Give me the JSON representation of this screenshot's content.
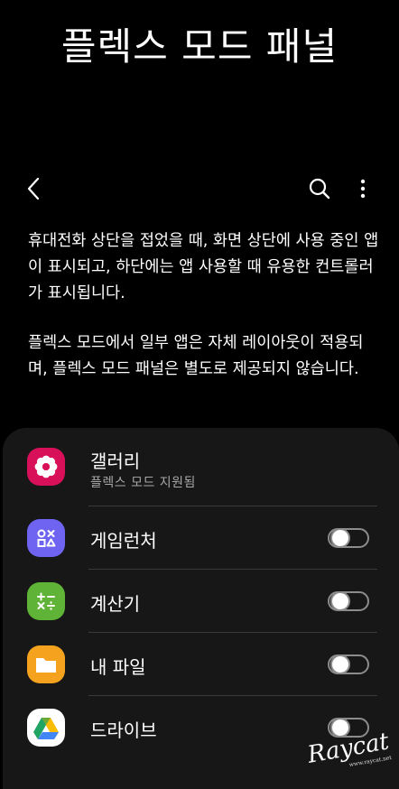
{
  "header": {
    "title": "플렉스 모드 패널"
  },
  "toolbar": {
    "back_icon": "back-arrow-icon",
    "search_icon": "search-icon",
    "more_icon": "more-vertical-icon"
  },
  "description": {
    "line1": "휴대전화 상단을 접었을 때, 화면 상단에 사용 중인 앱이 표시되고, 하단에는 앱 사용할 때 유용한 컨트롤러가 표시됩니다.",
    "line2": "플렉스 모드에서 일부 앱은 자체 레이아웃이 적용되며, 플렉스 모드 패널은 별도로 제공되지 않습니다."
  },
  "apps": [
    {
      "name": "갤러리",
      "subtitle": "플렉스 모드 지원됨",
      "icon": "gallery-icon",
      "color": "#d8105a",
      "toggle": null
    },
    {
      "name": "게임런처",
      "subtitle": "",
      "icon": "game-launcher-icon",
      "color": "#6f63f2",
      "toggle": false
    },
    {
      "name": "계산기",
      "subtitle": "",
      "icon": "calculator-icon",
      "color": "#5fb336",
      "toggle": false
    },
    {
      "name": "내 파일",
      "subtitle": "",
      "icon": "folder-icon",
      "color": "#f5a21f",
      "toggle": false
    },
    {
      "name": "드라이브",
      "subtitle": "",
      "icon": "google-drive-icon",
      "color": "#ffffff",
      "toggle": false
    }
  ],
  "watermark": {
    "text": "Raycat",
    "small": "www.raycat.net"
  }
}
